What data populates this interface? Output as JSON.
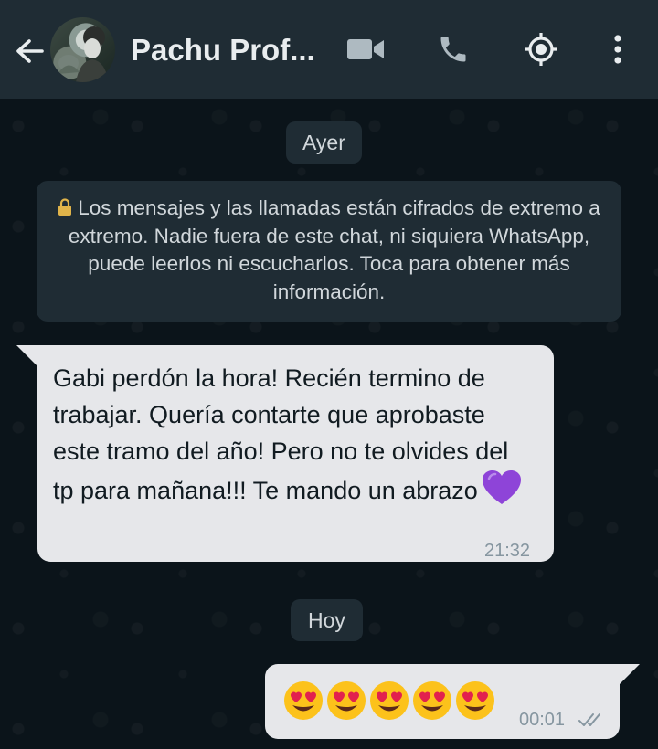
{
  "header": {
    "contact_name": "Pachu Prof...",
    "icons": [
      "back-arrow-icon",
      "video-call-icon",
      "phone-icon",
      "location-icon",
      "more-vertical-icon"
    ]
  },
  "chat": {
    "date_separators": [
      "Ayer",
      "Hoy"
    ],
    "encryption_notice": "Los mensajes y las llamadas están cifrados de extremo a extremo. Nadie fuera de este chat, ni siquiera WhatsApp, puede leerlos ni escucharlos. Toca para obtener más información.",
    "messages": [
      {
        "direction": "incoming",
        "text": "Gabi perdón la hora! Recién termino de trabajar. Quería contarte que aprobaste este tramo del año! Pero no te olvides del tp para mañana!!! Te mando un abrazo",
        "emoji": "purple-heart",
        "time": "21:32"
      },
      {
        "direction": "outgoing",
        "emoji": [
          "heart-eyes",
          "heart-eyes",
          "heart-eyes",
          "heart-eyes",
          "heart-eyes"
        ],
        "time": "00:01",
        "status": "delivered-double-tick"
      }
    ]
  },
  "colors": {
    "header_bg": "#1f2c34",
    "chat_bg": "#0b141a",
    "bubble_bg": "#e6e7ea",
    "tick_color": "#8696a0"
  }
}
